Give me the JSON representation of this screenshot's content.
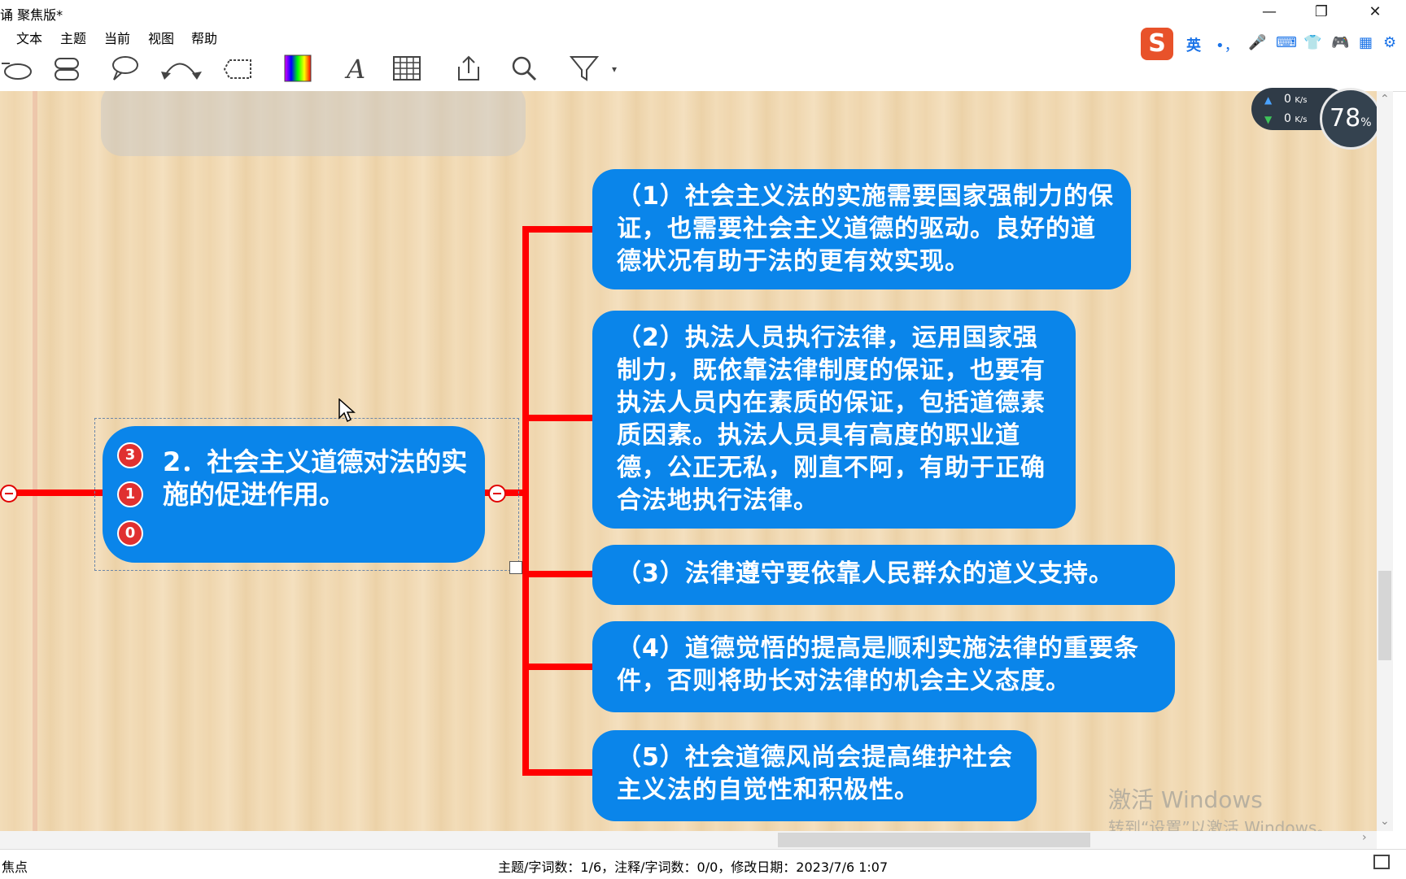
{
  "window": {
    "title": "诵 聚焦版*"
  },
  "menu": [
    "文本",
    "主题",
    "当前",
    "视图",
    "帮助"
  ],
  "toolbar": {
    "tools": [
      "topic-shape-icon",
      "subtopic-shape-icon",
      "callout-icon",
      "relationship-arrow-icon",
      "boundary-icon",
      "color-palette-icon",
      "text-format-icon",
      "table-icon",
      "export-icon",
      "search-icon",
      "filter-icon"
    ]
  },
  "ime": {
    "lang": "英",
    "punct": "•，",
    "icons": [
      "microphone-icon",
      "keyboard-icon",
      "skin-icon",
      "game-icon",
      "apps-icon",
      "settings-icon"
    ]
  },
  "net_monitor": {
    "upload": "0",
    "download": "0",
    "unit": "K/s",
    "percent": "78",
    "percent_symbol": "%"
  },
  "central": {
    "text": "2．社会主义道德对法的实施的促进作用。",
    "badges": [
      "3",
      "1",
      "0"
    ]
  },
  "branches": [
    {
      "text": "（1）社会主义法的实施需要国家强制力的保证，也需要社会主义道德的驱动。良好的道德状况有助于法的更有效实现。"
    },
    {
      "text": "（2）执法人员执行法律，运用国家强制力，既依靠法律制度的保证，也要有执法人员内在素质的保证，包括道德素质因素。执法人员具有高度的职业道德，公正无私，刚直不阿，有助于正确合法地执行法律。"
    },
    {
      "text": "（3）法律遵守要依靠人民群众的道义支持。"
    },
    {
      "text": "（4）道德觉悟的提高是顺利实施法律的重要条件，否则将助长对法律的机会主义态度。"
    },
    {
      "text": "（5）社会道德风尚会提高维护社会主义法的自觉性和积极性。"
    }
  ],
  "watermark": {
    "line1": "激活 Windows",
    "line2": "转到“设置”以激活 Windows。"
  },
  "status": {
    "left": "焦点",
    "center": "主题/字词数：1/6，注释/字词数：0/0，修改日期：2023/7/6 1:07"
  },
  "colors": {
    "node_blue": "#0a85ea",
    "line_red": "#ff0000",
    "badge_red": "#e03030"
  }
}
